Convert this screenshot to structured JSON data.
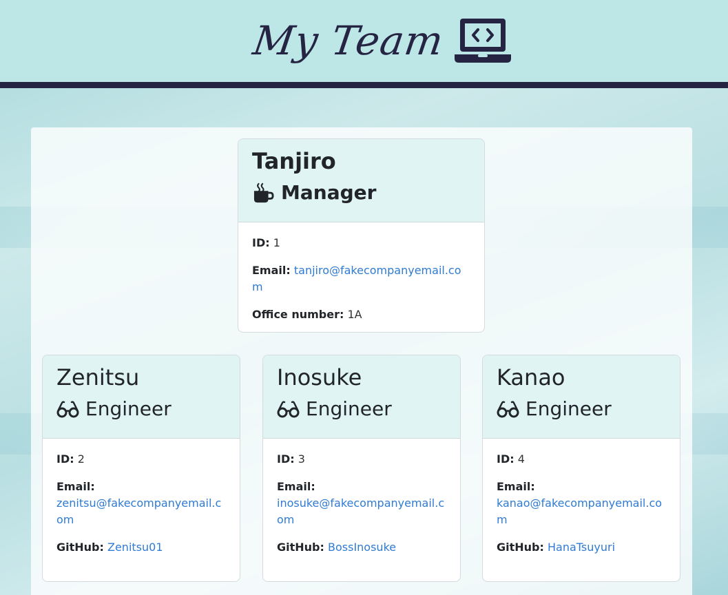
{
  "header": {
    "title": "My Team",
    "icon": "laptop-code-icon",
    "colors": {
      "background": "#bde6e7",
      "accent": "#262443"
    }
  },
  "manager": {
    "name": "Tanjiro",
    "role": "Manager",
    "role_icon": "coffee-mug-icon",
    "id_label": "ID:",
    "id": "1",
    "email_label": "Email:",
    "email": "tanjiro@fakecompanyemail.com",
    "office_label": "Office number:",
    "office": "1A"
  },
  "engineers": [
    {
      "name": "Zenitsu",
      "role": "Engineer",
      "role_icon": "glasses-icon",
      "id_label": "ID:",
      "id": "2",
      "email_label": "Email:",
      "email": "zenitsu@fakecompanyemail.com",
      "github_label": "GitHub:",
      "github": "Zenitsu01"
    },
    {
      "name": "Inosuke",
      "role": "Engineer",
      "role_icon": "glasses-icon",
      "id_label": "ID:",
      "id": "3",
      "email_label": "Email:",
      "email": "inosuke@fakecompanyemail.com",
      "github_label": "GitHub:",
      "github": "BossInosuke"
    },
    {
      "name": "Kanao",
      "role": "Engineer",
      "role_icon": "glasses-icon",
      "id_label": "ID:",
      "id": "4",
      "email_label": "Email:",
      "email": "kanao@fakecompanyemail.com",
      "github_label": "GitHub:",
      "github": "HanaTsuyuri"
    }
  ],
  "colors": {
    "link": "#2f7bd3",
    "card_header": "#e0f4f4"
  }
}
